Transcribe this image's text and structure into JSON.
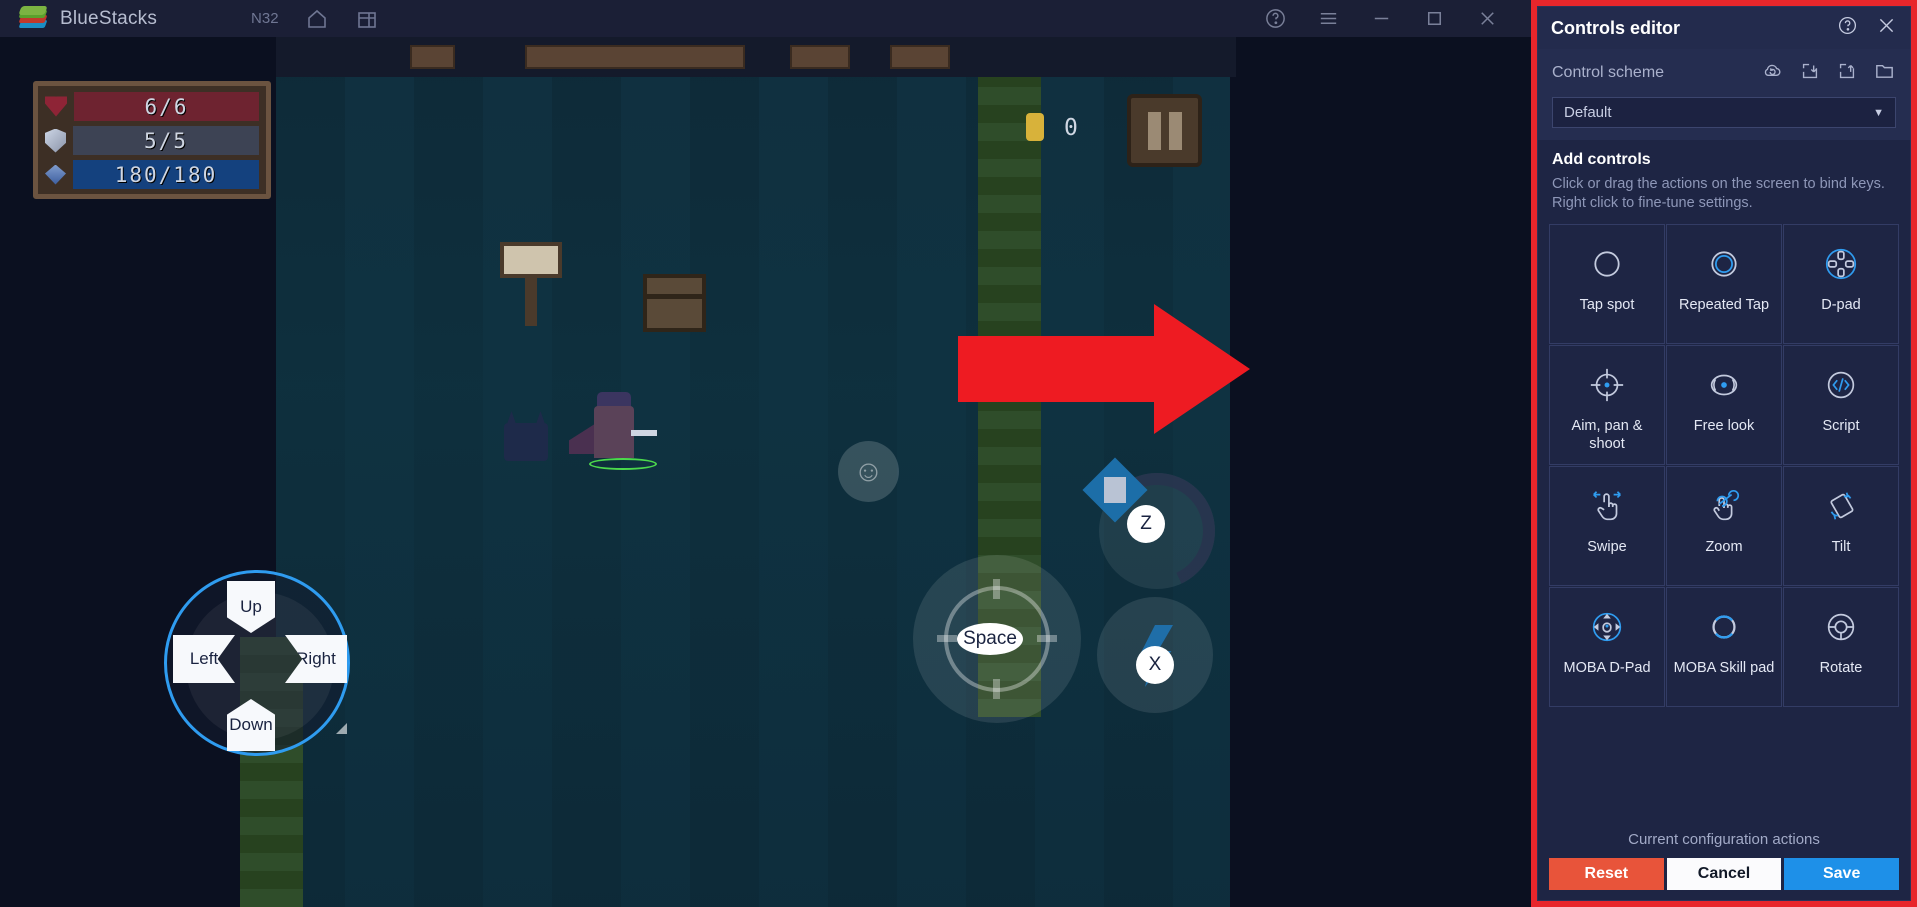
{
  "titlebar": {
    "app_name": "BlueStacks",
    "instance": "N32",
    "icons": {
      "logo": "bluestacks-logo",
      "home": "home-icon",
      "multi_instance": "multi-instance-icon",
      "help": "help-icon",
      "menu": "hamburger-menu-icon",
      "minimize": "minimize-icon",
      "maximize": "maximize-icon",
      "close": "close-icon"
    }
  },
  "game": {
    "hud": {
      "health": "6/6",
      "shield": "5/5",
      "mana": "180/180",
      "coins": "0"
    },
    "overlays": {
      "dpad": {
        "up": "Up",
        "down": "Down",
        "left": "Left",
        "right": "Right"
      },
      "space_key": "Space",
      "z_key": "Z",
      "x_key": "X"
    }
  },
  "panel": {
    "title": "Controls editor",
    "help_icon": "help-circle-icon",
    "close_icon": "close-icon",
    "scheme": {
      "label": "Control scheme",
      "selected": "Default",
      "icons": {
        "restore": "cloud-restore-icon",
        "import": "import-icon",
        "export": "export-icon",
        "folder": "folder-icon"
      }
    },
    "add_controls": {
      "title": "Add controls",
      "description": "Click or drag the actions on the screen to bind keys. Right click to fine-tune settings."
    },
    "controls": [
      {
        "label": "Tap spot",
        "icon": "tap-spot-icon"
      },
      {
        "label": "Repeated Tap",
        "icon": "repeated-tap-icon"
      },
      {
        "label": "D-pad",
        "icon": "dpad-icon"
      },
      {
        "label": "Aim, pan & shoot",
        "icon": "aim-pan-shoot-icon"
      },
      {
        "label": "Free look",
        "icon": "free-look-icon"
      },
      {
        "label": "Script",
        "icon": "script-icon"
      },
      {
        "label": "Swipe",
        "icon": "swipe-icon"
      },
      {
        "label": "Zoom",
        "icon": "zoom-icon"
      },
      {
        "label": "Tilt",
        "icon": "tilt-icon"
      },
      {
        "label": "MOBA D-Pad",
        "icon": "moba-dpad-icon"
      },
      {
        "label": "MOBA Skill pad",
        "icon": "moba-skill-pad-icon"
      },
      {
        "label": "Rotate",
        "icon": "rotate-icon"
      }
    ],
    "footer": {
      "title": "Current configuration actions",
      "reset": "Reset",
      "cancel": "Cancel",
      "save": "Save"
    }
  },
  "annotation": {
    "arrow": "red-arrow-pointing-right",
    "color": "#ee1b22"
  },
  "colors": {
    "panel_border": "#e8262b",
    "panel_bg": "#1e2544",
    "accent_blue": "#1e90e8",
    "reset_red": "#e8543a"
  }
}
